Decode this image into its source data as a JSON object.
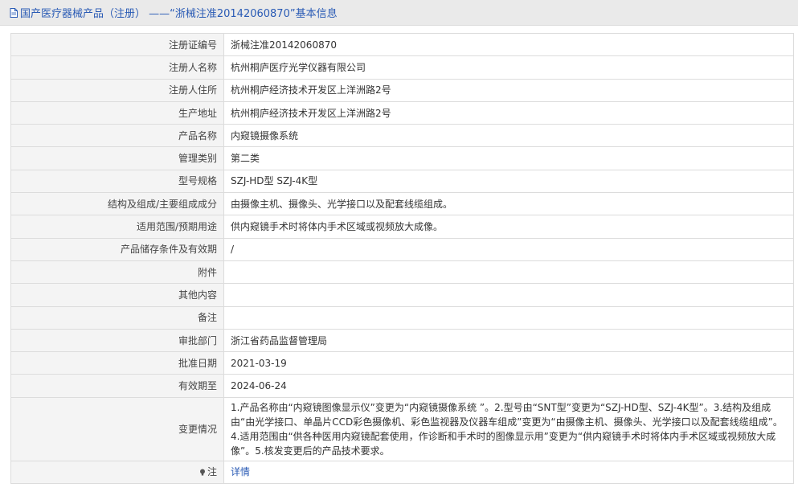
{
  "header": {
    "title": "国产医疗器械产品（注册） ——“浙械注准20142060870”基本信息"
  },
  "rows": [
    {
      "label": "注册证编号",
      "value": "浙械注准20142060870"
    },
    {
      "label": "注册人名称",
      "value": "杭州桐庐医疗光学仪器有限公司"
    },
    {
      "label": "注册人住所",
      "value": "杭州桐庐经济技术开发区上洋洲路2号"
    },
    {
      "label": "生产地址",
      "value": "杭州桐庐经济技术开发区上洋洲路2号"
    },
    {
      "label": "产品名称",
      "value": "内窥镜摄像系统"
    },
    {
      "label": "管理类别",
      "value": "第二类"
    },
    {
      "label": "型号规格",
      "value": "SZJ-HD型 SZJ-4K型"
    },
    {
      "label": "结构及组成/主要组成成分",
      "value": "由摄像主机、摄像头、光学接口以及配套线缆组成。"
    },
    {
      "label": "适用范围/预期用途",
      "value": "供内窥镜手术时将体内手术区域或视频放大成像。"
    },
    {
      "label": "产品储存条件及有效期",
      "value": "/"
    },
    {
      "label": "附件",
      "value": ""
    },
    {
      "label": "其他内容",
      "value": ""
    },
    {
      "label": "备注",
      "value": ""
    },
    {
      "label": "审批部门",
      "value": "浙江省药品监督管理局"
    },
    {
      "label": "批准日期",
      "value": "2021-03-19"
    },
    {
      "label": "有效期至",
      "value": "2024-06-24"
    },
    {
      "label": "变更情况",
      "value": "1.产品名称由“内窥镜图像显示仪”变更为“内窥镜摄像系统 ”。2.型号由“SNT型”变更为“SZJ-HD型、SZJ-4K型”。3.结构及组成由“由光学接口、单晶片CCD彩色摄像机、彩色监视器及仪器车组成”变更为“由摄像主机、摄像头、光学接口以及配套线缆组成”。4.适用范围由“供各种医用内窥镜配套使用，作诊断和手术时的图像显示用”变更为“供内窥镜手术时将体内手术区域或视频放大成像”。5.核发变更后的产品技术要求。"
    }
  ],
  "note": {
    "label": "注",
    "link_text": "详情"
  }
}
